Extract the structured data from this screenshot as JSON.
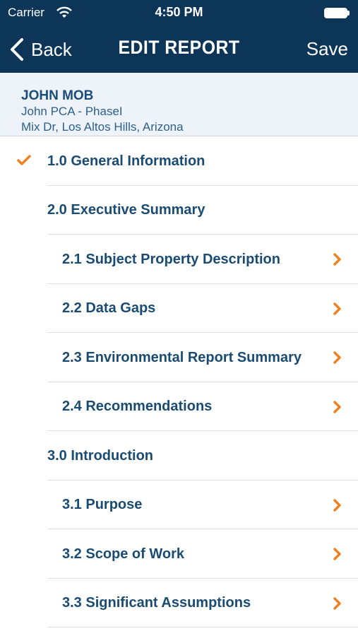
{
  "status_bar": {
    "carrier": "Carrier",
    "time": "4:50 PM"
  },
  "nav": {
    "back_label": "Back",
    "title": "EDIT REPORT",
    "save_label": "Save"
  },
  "report_header": {
    "name": "JOHN MOB",
    "project": "John PCA - PhaseI",
    "address": "Mix Dr, Los Altos Hills, Arizona"
  },
  "sections": [
    {
      "label": "1.0 General Information",
      "level": 1,
      "checked": true,
      "has_arrow": false
    },
    {
      "label": "2.0 Executive Summary",
      "level": 1,
      "checked": false,
      "has_arrow": false
    },
    {
      "label": "2.1 Subject Property Description",
      "level": 2,
      "checked": false,
      "has_arrow": true
    },
    {
      "label": "2.2 Data Gaps",
      "level": 2,
      "checked": false,
      "has_arrow": true
    },
    {
      "label": "2.3 Environmental Report Summary",
      "level": 2,
      "checked": false,
      "has_arrow": true
    },
    {
      "label": "2.4 Recommendations",
      "level": 2,
      "checked": false,
      "has_arrow": true
    },
    {
      "label": "3.0 Introduction",
      "level": 1,
      "checked": false,
      "has_arrow": false
    },
    {
      "label": "3.1 Purpose",
      "level": 2,
      "checked": false,
      "has_arrow": true
    },
    {
      "label": "3.2 Scope of Work",
      "level": 2,
      "checked": false,
      "has_arrow": true
    },
    {
      "label": "3.3 Significant Assumptions",
      "level": 2,
      "checked": false,
      "has_arrow": true
    }
  ],
  "colors": {
    "nav_background": "#0c3557",
    "header_background": "#edf3f9",
    "section_text": "#1a4b72",
    "accent_orange": "#f07f1e"
  }
}
